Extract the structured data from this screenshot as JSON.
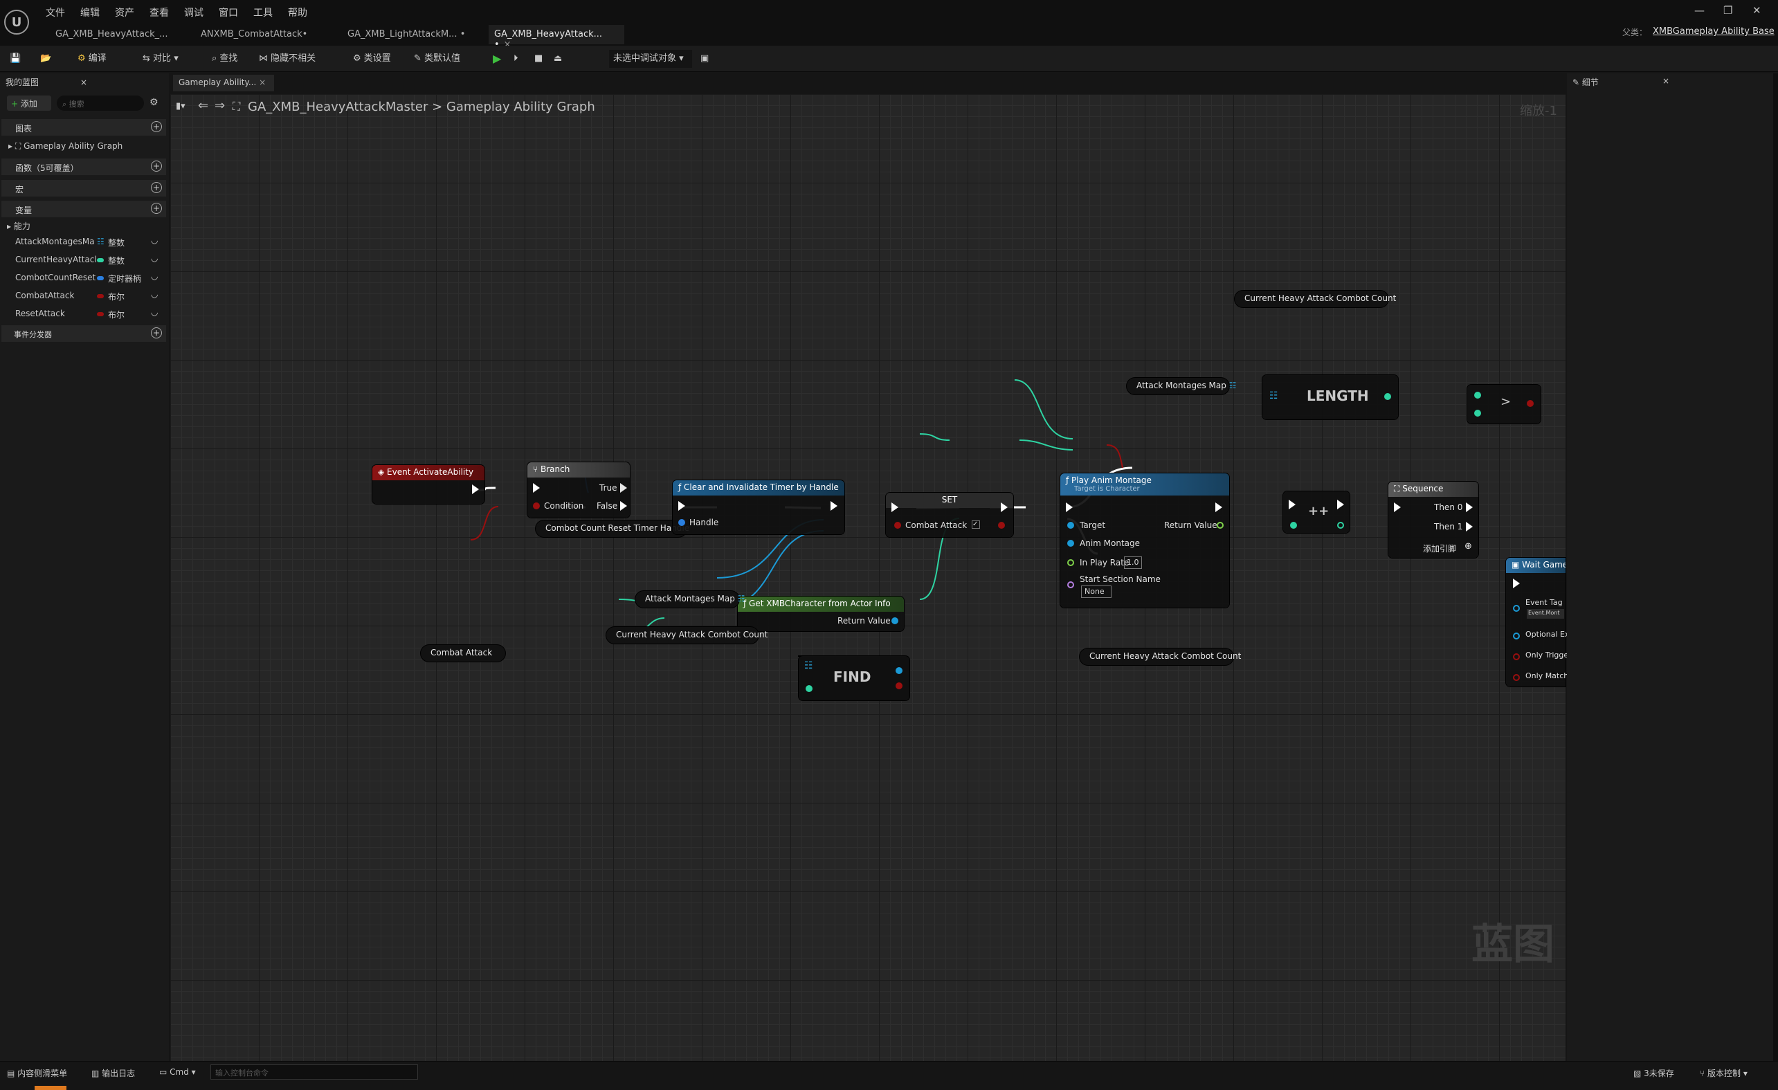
{
  "menu": [
    "文件",
    "编辑",
    "资产",
    "查看",
    "调试",
    "窗口",
    "工具",
    "帮助"
  ],
  "tabs": [
    "GA_XMB_HeavyAttack_...",
    "ANXMB_CombatAttack•",
    "GA_XMB_LightAttackM... •",
    "GA_XMB_HeavyAttack... •"
  ],
  "parent": {
    "label": "父类：",
    "value": "XMBGameplay Ability Base"
  },
  "toolbar": {
    "compile": "编译",
    "diff": "对比",
    "find": "查找",
    "hide": "隐藏不相关",
    "class_settings": "类设置",
    "class_defaults": "类默认值",
    "debug_object": "未选中调试对象"
  },
  "left_panel": {
    "tab": "我的蓝图",
    "add": "添加",
    "search_placeholder": "搜索",
    "graph_section": "图表",
    "graph_item": "Gameplay Ability Graph",
    "functions": "函数（5可覆盖）",
    "macros": "宏",
    "variables": "变量",
    "category": "能力",
    "vars": [
      {
        "name": "AttackMontagesMa",
        "type": "整数",
        "color": "#2aa7e0"
      },
      {
        "name": "CurrentHeavyAttacl",
        "type": "整数",
        "color": "#2ed3a2"
      },
      {
        "name": "CombotCountReset",
        "type": "定时器柄",
        "color": "#2a7fe0"
      },
      {
        "name": "CombatAttack",
        "type": "布尔",
        "color": "#9a0f0f"
      },
      {
        "name": "ResetAttack",
        "type": "布尔",
        "color": "#9a0f0f"
      }
    ],
    "dispatchers": "事件分发器"
  },
  "graph_tab": "Gameplay Ability...",
  "breadcrumb": {
    "root": "GA_XMB_HeavyAttackMaster",
    "leaf": "Gameplay Ability Graph",
    "zoom": "缩放-1"
  },
  "details": {
    "tab": "细节"
  },
  "watermark": "蓝图",
  "nodes": {
    "event": "Event ActivateAbility",
    "branch": "Branch",
    "branch_true": "True",
    "branch_false": "False",
    "branch_cond": "Condition",
    "combat_attack": "Combat Attack",
    "timer_handle": "Combot Count Reset Timer Handle",
    "clear_timer": "Clear and Invalidate Timer by Handle",
    "handle": "Handle",
    "set": "SET",
    "set_var": "Combat Attack",
    "play_montage": "Play Anim Montage",
    "target_is": "Target is Character",
    "target": "Target",
    "return_value": "Return Value",
    "anim_montage": "Anim Montage",
    "in_play_rate": "In Play Rate",
    "rate_value": "1.0",
    "start_section": "Start Section Name",
    "section_value": "None",
    "get_char": "Get XMBCharacter from Actor Info",
    "montages_map": "Attack Montages Map",
    "find": "FIND",
    "length": "LENGTH",
    "combo_count": "Current Heavy Attack Combot Count",
    "increment": "++",
    "greater": ">",
    "sequence": "Sequence",
    "then0": "Then 0",
    "then1": "Then 1",
    "add_pin": "添加引脚",
    "wait": "Wait Gamep",
    "event_tag": "Event Tag",
    "event_tag_val": "Event.Mont",
    "optional": "Optional Ex",
    "only_trigger": "Only Trigge",
    "only_match": "Only Match"
  },
  "status": {
    "content": "内容侧滑菜单",
    "output": "输出日志",
    "cmd": "Cmd",
    "console_placeholder": "输入控制台命令",
    "unsaved": "3未保存",
    "source": "版本控制"
  }
}
